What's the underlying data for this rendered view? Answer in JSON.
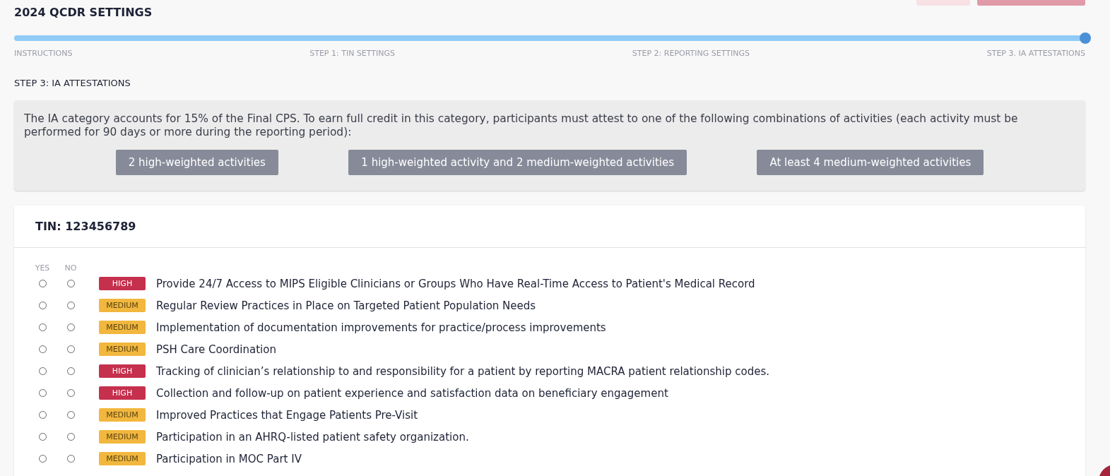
{
  "page_title": "2024 QCDR SETTINGS",
  "progress": {
    "level": 1,
    "steps": [
      "INSTRUCTIONS",
      "STEP 1: TIN SETTINGS",
      "STEP 2: REPORTING SETTINGS",
      "STEP 3. IA ATTESTATIONS"
    ]
  },
  "section_title": "STEP 3: IA ATTESTATIONS",
  "info": {
    "text": "The IA category accounts for 15% of the Final CPS. To earn full credit in this category, participants must attest to one of the following combinations of activities (each activity must be performed for 90 days or more during the reporting period):",
    "options": [
      "2 high-weighted activities",
      "1 high-weighted activity and 2 medium-weighted activities",
      "At least 4 medium-weighted activities"
    ]
  },
  "tin": {
    "title": "TIN: 123456789",
    "columns": [
      "YES",
      "NO"
    ],
    "activities": [
      {
        "yes": false,
        "no": false,
        "kind": "high",
        "weight": "HIGH",
        "name": "Provide 24/7 Access to MIPS Eligible Clinicians or Groups Who Have Real-Time Access to Patient's Medical Record"
      },
      {
        "yes": false,
        "no": false,
        "kind": "medium",
        "weight": "MEDIUM",
        "name": "Regular Review Practices in Place on Targeted Patient Population Needs"
      },
      {
        "yes": false,
        "no": false,
        "kind": "medium",
        "weight": "MEDIUM",
        "name": "Implementation of documentation improvements for practice/process improvements"
      },
      {
        "yes": false,
        "no": false,
        "kind": "medium",
        "weight": "MEDIUM",
        "name": "PSH Care Coordination"
      },
      {
        "yes": false,
        "no": false,
        "kind": "high",
        "weight": "HIGH",
        "name": "Tracking of clinician’s relationship to and responsibility for a patient by reporting MACRA patient relationship codes."
      },
      {
        "yes": false,
        "no": false,
        "kind": "high",
        "weight": "HIGH",
        "name": "Collection and follow-up on patient experience and satisfaction data on beneficiary engagement"
      },
      {
        "yes": false,
        "no": false,
        "kind": "medium",
        "weight": "MEDIUM",
        "name": "Improved Practices that Engage Patients Pre-Visit"
      },
      {
        "yes": false,
        "no": false,
        "kind": "medium",
        "weight": "MEDIUM",
        "name": "Participation in an AHRQ-listed patient safety organization."
      },
      {
        "yes": false,
        "no": false,
        "kind": "medium",
        "weight": "MEDIUM",
        "name": "Participation in MOC Part IV"
      }
    ]
  }
}
